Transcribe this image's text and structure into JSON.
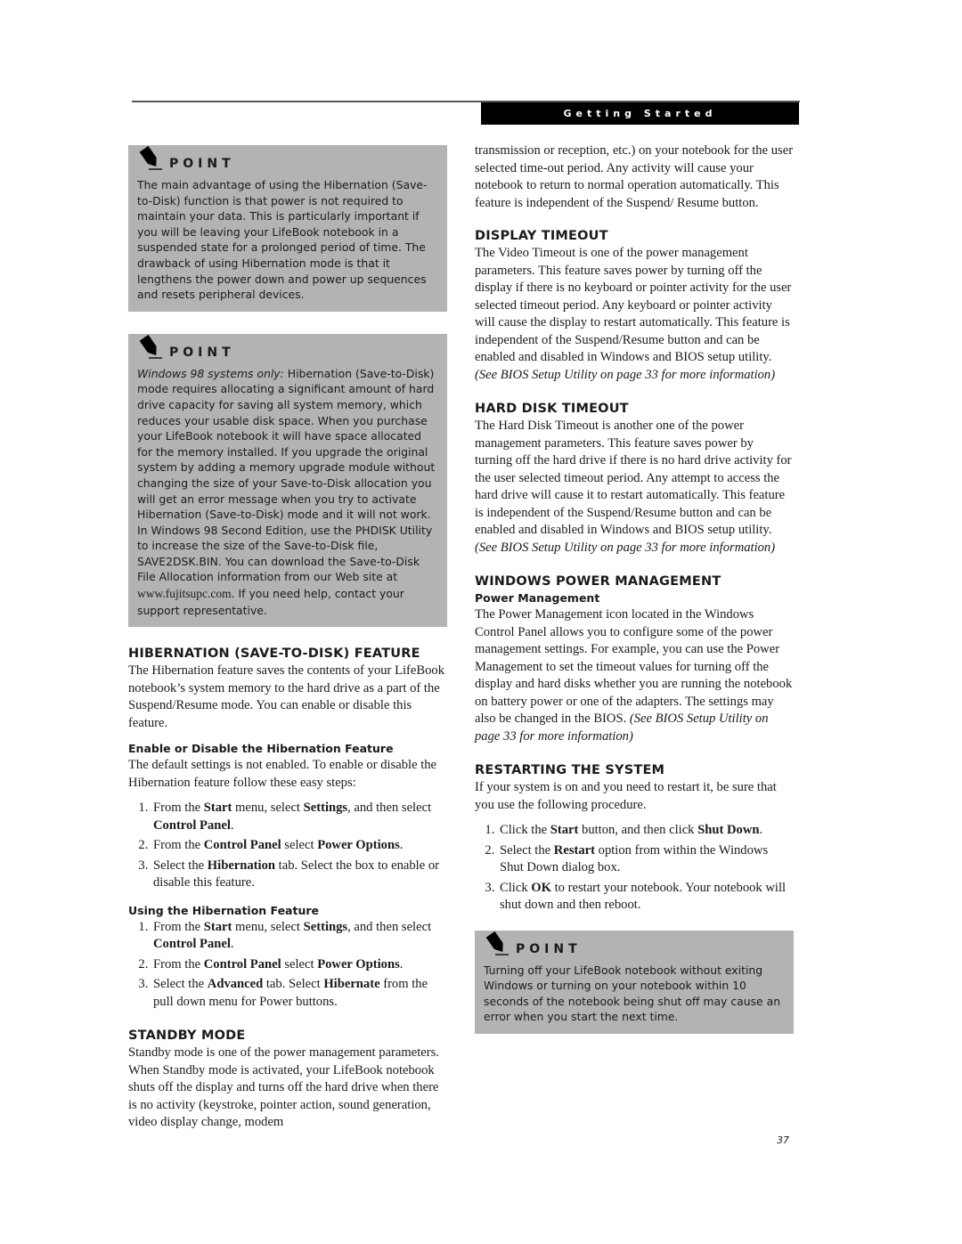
{
  "header": {
    "section_title": "Getting Started"
  },
  "left_column": {
    "point1": {
      "title": "POINT",
      "text": "The main advantage of using the Hibernation (Save-to-Disk) function is that power is not required to maintain your data. This is particularly important if you will be leaving your LifeBook notebook in a suspended state for a prolonged period of time. The drawback of using Hibernation mode is that it lengthens the power down and power up sequences and resets peripheral devices."
    },
    "point2": {
      "title": "POINT",
      "lead_italic": "Windows 98 systems only:",
      "text": " Hibernation (Save-to-Disk) mode requires allocating a significant amount of hard drive capacity for saving all system memory, which reduces your usable disk space. When you purchase your LifeBook notebook it will have space allocated for the memory installed. If you upgrade the original system by adding a memory upgrade module without changing the size of your Save-to-Disk allocation you will get an error message when you try to activate Hibernation (Save-to-Disk) mode and it will not work. In Windows 98 Second Edition, use the PHDISK Utility to increase the size of the Save-to-Disk file, SAVE2DSK.BIN. You can download the Save-to-Disk File Allocation information from our Web site at ",
      "link": "www.fujitsupc.com",
      "text_after": ". If you need help, contact your support representative."
    },
    "hibernation": {
      "heading": "HIBERNATION (SAVE-TO-DISK) FEATURE",
      "body": "The Hibernation feature saves the contents of your LifeBook notebook’s system memory to the hard drive as a part of the Suspend/Resume mode. You can enable or disable this feature.",
      "enable_heading": "Enable or Disable the Hibernation Feature",
      "enable_body": "The default settings is not enabled. To enable or disable the Hibernation feature follow these easy steps:",
      "enable_steps": [
        {
          "a": "From the ",
          "b1": "Start",
          "c": " menu, select ",
          "b2": "Settings",
          "d": ", and then select ",
          "b3": "Control Panel",
          "e": "."
        },
        {
          "a": "From the ",
          "b1": "Control Panel",
          "c": " select ",
          "b2": "Power Options",
          "d": ".",
          "b3": "",
          "e": ""
        },
        {
          "a": "Select the ",
          "b1": "Hibernation",
          "c": " tab. Select the box to enable or disable this feature.",
          "b2": "",
          "d": "",
          "b3": "",
          "e": ""
        }
      ],
      "using_heading": "Using the Hibernation Feature",
      "using_steps": [
        {
          "a": "From the ",
          "b1": "Start",
          "c": " menu, select ",
          "b2": "Settings",
          "d": ", and then select ",
          "b3": "Control Panel",
          "e": "."
        },
        {
          "a": "From the ",
          "b1": "Control Panel",
          "c": " select ",
          "b2": "Power Options",
          "d": ".",
          "b3": "",
          "e": ""
        },
        {
          "a": "Select the ",
          "b1": "Advanced",
          "c": " tab. Select ",
          "b2": "Hibernate",
          "d": " from the pull down menu for Power buttons.",
          "b3": "",
          "e": ""
        }
      ]
    },
    "standby": {
      "heading": "STANDBY MODE",
      "body": "Standby mode is one of the power management parameters. When Standby mode is activated, your LifeBook notebook shuts off the display and turns off the hard drive when there is no activity (keystroke, pointer action, sound generation, video display change, modem"
    }
  },
  "right_column": {
    "standby_continued": "transmission or reception, etc.) on your notebook for the user selected time-out period. Any activity will cause your notebook to return to normal operation automatically. This feature is independent of the Suspend/ Resume button.",
    "display_timeout": {
      "heading": "DISPLAY TIMEOUT",
      "body": "The Video Timeout is one of the power management parameters. This feature saves power by turning off the display if there is no keyboard or pointer activity for the user selected timeout period. Any keyboard or pointer activity will cause the display to restart automatically. This feature is independent of the Suspend/Resume button and can be enabled and disabled in Windows and BIOS setup utility. ",
      "ref": "(See BIOS Setup Utility on page 33 for more information)"
    },
    "hard_disk_timeout": {
      "heading": "HARD DISK TIMEOUT",
      "body": "The Hard Disk Timeout is another one of the power management parameters. This feature saves power by turning off the hard drive if there is no hard drive activity for the user selected timeout period. Any attempt to access the hard drive will cause it to restart automatically. This feature is independent of the Suspend/Resume button and can be enabled and disabled in Windows and BIOS setup utility. ",
      "ref": "(See BIOS Setup Utility on page 33 for more information)"
    },
    "windows_pm": {
      "heading": "WINDOWS POWER MANAGEMENT",
      "subheading": "Power Management",
      "body": "The Power Management icon located in the Windows Control Panel allows you to configure some of the power management settings. For example, you can use the Power Management to set the timeout values for turning off the display and hard disks whether you are running the notebook on battery power or one of the adapters. The settings may also be changed in the BIOS. ",
      "ref": "(See BIOS Setup Utility on page 33 for more information)"
    },
    "restarting": {
      "heading": "RESTARTING THE SYSTEM",
      "body": "If your system is on and you need to restart it, be sure that you use the following procedure.",
      "steps": [
        {
          "a": "Click the ",
          "b1": "Start",
          "c": " button, and then click ",
          "b2": "Shut Down",
          "d": "."
        },
        {
          "a": "Select the ",
          "b1": "Restart",
          "c": " option from within the Windows Shut Down dialog box.",
          "b2": "",
          "d": ""
        },
        {
          "a": "Click ",
          "b1": "OK",
          "c": " to restart your notebook. Your notebook will shut down and then reboot.",
          "b2": "",
          "d": ""
        }
      ]
    },
    "point3": {
      "title": "POINT",
      "text": "Turning off your LifeBook notebook without exiting Windows or turning on your notebook within 10 seconds of the notebook being shut off may cause an error when you start the next time."
    }
  },
  "footer": {
    "page_number": "37"
  }
}
